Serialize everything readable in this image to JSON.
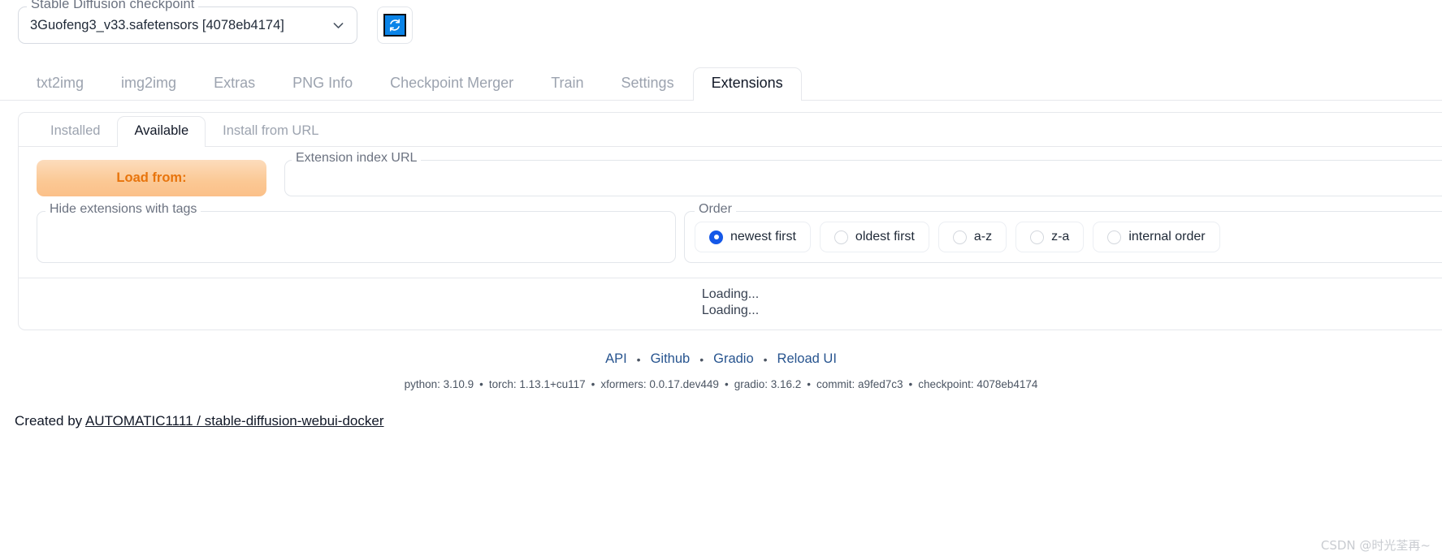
{
  "checkpoint": {
    "label": "Stable Diffusion checkpoint",
    "value": "3Guofeng3_v33.safetensors [4078eb4174]",
    "dropdown_icon": "chevron-down-icon",
    "refresh_icon": "refresh-icon"
  },
  "tabs": [
    {
      "label": "txt2img",
      "active": false
    },
    {
      "label": "img2img",
      "active": false
    },
    {
      "label": "Extras",
      "active": false
    },
    {
      "label": "PNG Info",
      "active": false
    },
    {
      "label": "Checkpoint Merger",
      "active": false
    },
    {
      "label": "Train",
      "active": false
    },
    {
      "label": "Settings",
      "active": false
    },
    {
      "label": "Extensions",
      "active": true
    }
  ],
  "subtabs": [
    {
      "label": "Installed",
      "active": false
    },
    {
      "label": "Available",
      "active": true
    },
    {
      "label": "Install from URL",
      "active": false
    }
  ],
  "controls": {
    "load_from_label": "Load from:",
    "index_url_label": "Extension index URL",
    "index_url_value": "",
    "index_url_placeholder": "",
    "hide_tags_label": "Hide extensions with tags",
    "order_label": "Order",
    "order_options": [
      {
        "label": "newest first",
        "selected": true
      },
      {
        "label": "oldest first",
        "selected": false
      },
      {
        "label": "a-z",
        "selected": false
      },
      {
        "label": "z-a",
        "selected": false
      },
      {
        "label": "internal order",
        "selected": false
      }
    ]
  },
  "status": {
    "line1": "Loading...",
    "line2": "Loading..."
  },
  "footer": {
    "links": [
      "API",
      "Github",
      "Gradio",
      "Reload UI"
    ],
    "separator": "•",
    "versions": [
      "python: 3.10.9",
      "torch: 1.13.1+cu117",
      "xformers: 0.0.17.dev449",
      "gradio: 3.16.2",
      "commit: a9fed7c3",
      "checkpoint: 4078eb4174"
    ],
    "version_separator": "•"
  },
  "created": {
    "prefix": "Created by ",
    "link": "AUTOMATIC1111 / stable-diffusion-webui-docker"
  },
  "watermark": "CSDN @时光荃再~",
  "colors": {
    "accent_orange": "#e8740c",
    "radio_blue": "#1558e8",
    "refresh_blue": "#0a84e8",
    "link_blue": "#27548f"
  }
}
